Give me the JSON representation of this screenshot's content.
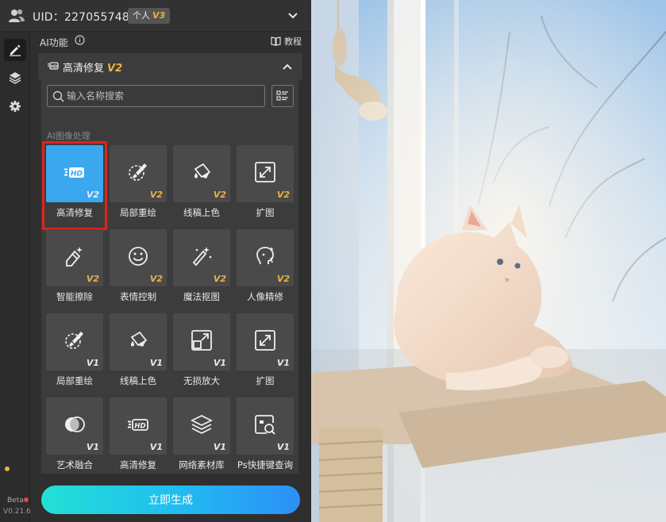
{
  "topbar": {
    "uid": "UID：2270557484",
    "plan": "个人",
    "plan_version": "V3"
  },
  "rail": {
    "beta": "Beta",
    "version": "V0.21.6"
  },
  "panel": {
    "section_title": "AI功能",
    "tutorial": "教程",
    "current_tool": "高清修复",
    "current_tool_version": "V2",
    "search_placeholder": "输入名称搜索",
    "category": "AI图像处理",
    "generate_label": "立即生成"
  },
  "tools": [
    {
      "label": "高清修复",
      "version": "V2",
      "icon": "hd-icon",
      "selected": true
    },
    {
      "label": "局部重绘",
      "version": "V2",
      "icon": "brush-icon"
    },
    {
      "label": "线稿上色",
      "version": "V2",
      "icon": "paint-bucket-icon"
    },
    {
      "label": "扩图",
      "version": "V2",
      "icon": "expand-icon"
    },
    {
      "label": "智能擦除",
      "version": "V2",
      "icon": "magic-eraser-icon"
    },
    {
      "label": "表情控制",
      "version": "V2",
      "icon": "smile-icon"
    },
    {
      "label": "魔法抠图",
      "version": "V2",
      "icon": "magic-wand-icon"
    },
    {
      "label": "人像精修",
      "version": "V2",
      "icon": "portrait-icon"
    },
    {
      "label": "局部重绘",
      "version": "V1",
      "icon": "brush-icon"
    },
    {
      "label": "线稿上色",
      "version": "V1",
      "icon": "paint-bucket-icon"
    },
    {
      "label": "无损放大",
      "version": "V1",
      "icon": "upscale-icon"
    },
    {
      "label": "扩图",
      "version": "V1",
      "icon": "expand-icon"
    },
    {
      "label": "艺术融合",
      "version": "V1",
      "icon": "blend-icon"
    },
    {
      "label": "高清修复",
      "version": "V1",
      "icon": "hd-icon"
    },
    {
      "label": "网络素材库",
      "version": "V1",
      "icon": "layers-icon"
    },
    {
      "label": "Ps快捷键查询",
      "version": "V1",
      "icon": "search-image-icon"
    }
  ]
}
